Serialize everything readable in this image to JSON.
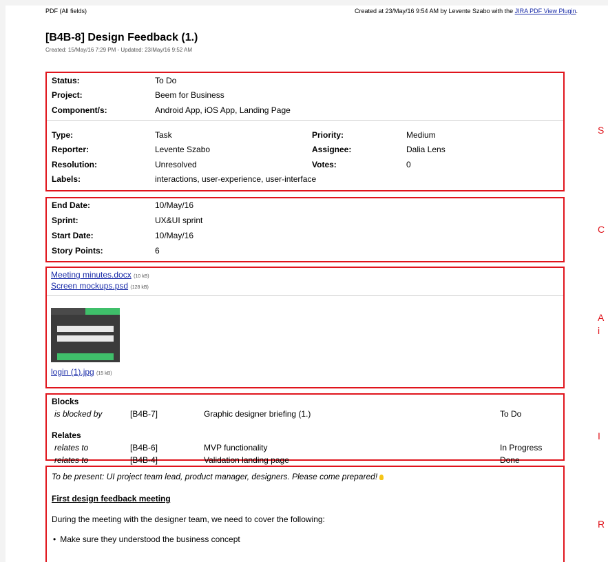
{
  "topbar": {
    "left": "PDF (All fields)",
    "right_prefix": "Created at 23/May/16 9:54 AM by Levente Szabo with the ",
    "right_link": "JIRA PDF View Plugin",
    "right_suffix": "."
  },
  "issue": {
    "title": "[B4B-8] Design Feedback (1.)",
    "meta": "Created: 15/May/16 7:29 PM - Updated: 23/May/16 9:52 AM"
  },
  "fields": {
    "status_label": "Status:",
    "status": "To Do",
    "project_label": "Project:",
    "project": "Beem for Business",
    "components_label": "Component/s:",
    "components": "Android App, iOS App, Landing Page",
    "type_label": "Type:",
    "type": "Task",
    "priority_label": "Priority:",
    "priority": "Medium",
    "reporter_label": "Reporter:",
    "reporter": "Levente Szabo",
    "assignee_label": "Assignee:",
    "assignee": "Dalia Lens",
    "resolution_label": "Resolution:",
    "resolution": "Unresolved",
    "votes_label": "Votes:",
    "votes": "0",
    "labels_label": "Labels:",
    "labels": "interactions, user-experience, user-interface"
  },
  "custom": {
    "end_date_label": "End Date:",
    "end_date": "10/May/16",
    "sprint_label": "Sprint:",
    "sprint": "UX&UI sprint",
    "start_date_label": "Start Date:",
    "start_date": "10/May/16",
    "story_points_label": "Story Points:",
    "story_points": "6"
  },
  "attachments": {
    "files": [
      {
        "name": "Meeting minutes.docx",
        "size": "(10 kB)"
      },
      {
        "name": "Screen mockups.psd",
        "size": "(128 kB)"
      }
    ],
    "image": {
      "name": "login (1).jpg",
      "size": "(15 kB)"
    }
  },
  "links": {
    "blocks_heading": "Blocks",
    "blocks": [
      {
        "relation": "is blocked by",
        "key": "[B4B-7]",
        "summary": "Graphic designer briefing (1.)",
        "status": "To Do"
      }
    ],
    "relates_heading": "Relates",
    "relates": [
      {
        "relation": "relates to",
        "key": "[B4B-6]",
        "summary": "MVP functionality",
        "status": "In Progress"
      },
      {
        "relation": "relates to",
        "key": "[B4B-4]",
        "summary": "Validation landing page",
        "status": "Done"
      }
    ]
  },
  "description": {
    "intro": "To be present: UI project team lead, product manager, designers. Please come prepared!",
    "heading": "First design feedback meeting",
    "para": "During the meeting with the designer team, we need to cover the following:",
    "bullets": [
      "Make sure they understood the business concept"
    ]
  },
  "side_labels": [
    "S",
    "C",
    "A",
    "i",
    "I",
    "R"
  ],
  "colors": {
    "highlight": "#e0141c",
    "link": "#1a2ca8"
  }
}
